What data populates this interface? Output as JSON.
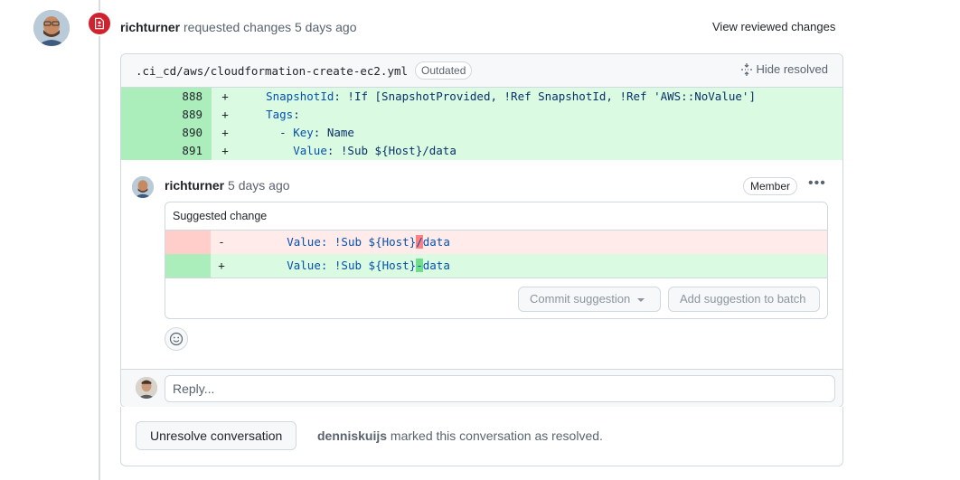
{
  "review": {
    "author": "richturner",
    "action": "requested changes",
    "time": "5 days ago",
    "view_reviewed_label": "View reviewed changes"
  },
  "thread": {
    "file_path": ".ci_cd/aws/cloudformation-create-ec2.yml",
    "outdated_label": "Outdated",
    "hide_resolved_label": "Hide resolved",
    "diff_lines": [
      {
        "num": "888",
        "sign": "+",
        "indent": "    ",
        "key": "SnapshotId",
        "rest": ": !If [SnapshotProvided, !Ref SnapshotId, !Ref 'AWS::NoValue']"
      },
      {
        "num": "889",
        "sign": "+",
        "indent": "    ",
        "key": "Tags",
        "rest": ":"
      },
      {
        "num": "890",
        "sign": "+",
        "indent": "      - ",
        "key": "Key",
        "rest": ": Name"
      },
      {
        "num": "891",
        "sign": "+",
        "indent": "        ",
        "key": "Value",
        "rest": ": !Sub ${Host}/data"
      }
    ]
  },
  "comment": {
    "author": "richturner",
    "time": "5 days ago",
    "role_badge": "Member",
    "suggestion_title": "Suggested change",
    "deleted": {
      "sign": "-",
      "indent": "        ",
      "key": "Value",
      "before": ": !Sub ${Host}",
      "changed": "/",
      "after": "data"
    },
    "added": {
      "sign": "+",
      "indent": "        ",
      "key": "Value",
      "before": ": !Sub ${Host}",
      "changed": "-",
      "after": "data"
    },
    "commit_label": "Commit suggestion",
    "batch_label": "Add suggestion to batch"
  },
  "reply": {
    "placeholder": "Reply..."
  },
  "resolution": {
    "button_label": "Unresolve conversation",
    "resolver": "denniskuijs",
    "message": " marked this conversation as resolved."
  },
  "colors": {
    "change_requested": "#cf222e",
    "addition_bg": "#dafbe1",
    "deletion_bg": "#ffebe9"
  }
}
